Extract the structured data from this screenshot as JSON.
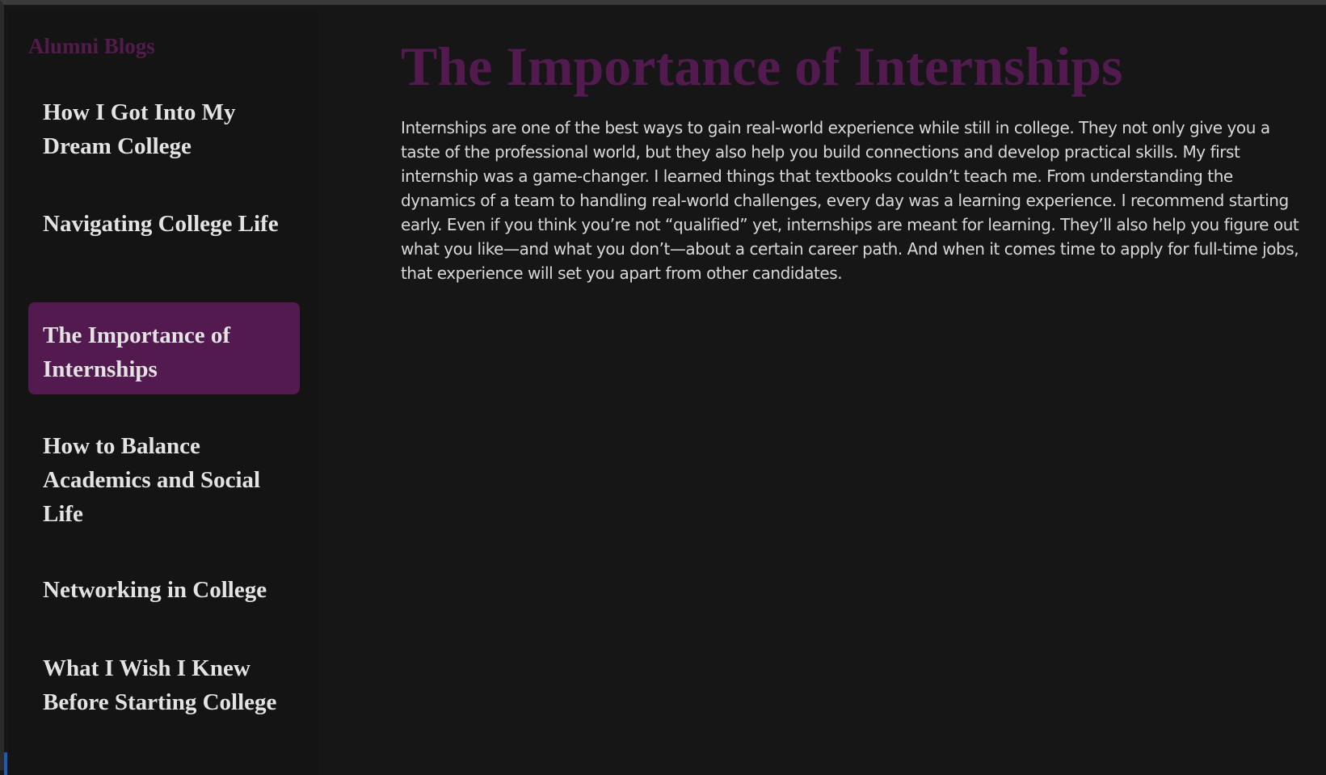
{
  "sidebar": {
    "title": "Alumni Blogs",
    "items": [
      {
        "label": "How I Got Into My Dream College",
        "active": false
      },
      {
        "label": "Navigating College Life",
        "active": false
      },
      {
        "label": "The Importance of Internships",
        "active": true
      },
      {
        "label": "How to Balance Academics and Social Life",
        "active": false
      },
      {
        "label": "Networking in College",
        "active": false
      },
      {
        "label": "What I Wish I Knew Before Starting College",
        "active": false
      }
    ]
  },
  "article": {
    "title": "The Importance of Internships",
    "body": "Internships are one of the best ways to gain real-world experience while still in college. They not only give you a taste of the professional world, but they also help you build connections and develop practical skills. My first internship was a game-changer. I learned things that textbooks couldn’t teach me. From understanding the dynamics of a team to handling real-world challenges, every day was a learning experience. I recommend starting early. Even if you think you’re not “qualified” yet, internships are meant for learning. They’ll also help you figure out what you like—and what you don’t—about a certain career path. And when it comes time to apply for full-time jobs, that experience will set you apart from other candidates."
  },
  "colors": {
    "accent": "#531a50",
    "background": "#161617",
    "sidebar_background": "#141414",
    "text": "#e3e3e3"
  }
}
